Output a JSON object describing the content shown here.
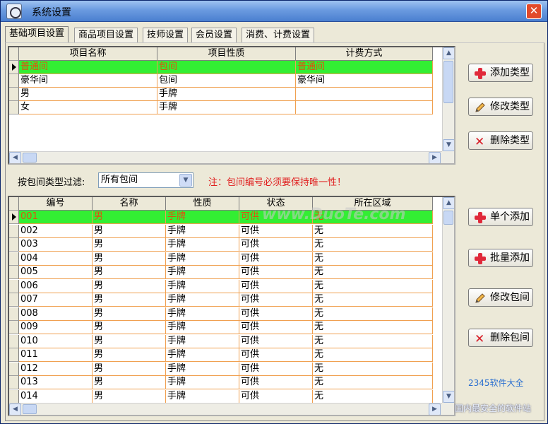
{
  "window": {
    "title": "系统设置",
    "close_label": "✕"
  },
  "tabs": [
    "基础项目设置",
    "商品项目设置",
    "技师设置",
    "会员设置",
    "消费、计费设置"
  ],
  "type_grid": {
    "columns": [
      "项目名称",
      "项目性质",
      "计费方式"
    ],
    "rows": [
      [
        "普通间",
        "包间",
        "普通间"
      ],
      [
        "豪华间",
        "包间",
        "豪华间"
      ],
      [
        "男",
        "手牌",
        ""
      ],
      [
        "女",
        "手牌",
        ""
      ]
    ],
    "selected_index": 0
  },
  "type_buttons": {
    "add": "添加类型",
    "edit": "修改类型",
    "delete": "删除类型"
  },
  "filter": {
    "label": "按包间类型过滤:",
    "value": "所有包间",
    "note": "注：包间编号必须要保持唯一性！"
  },
  "room_grid": {
    "columns": [
      "编号",
      "名称",
      "性质",
      "状态",
      "所在区域"
    ],
    "rows": [
      [
        "001",
        "男",
        "手牌",
        "可供",
        "无"
      ],
      [
        "002",
        "男",
        "手牌",
        "可供",
        "无"
      ],
      [
        "003",
        "男",
        "手牌",
        "可供",
        "无"
      ],
      [
        "004",
        "男",
        "手牌",
        "可供",
        "无"
      ],
      [
        "005",
        "男",
        "手牌",
        "可供",
        "无"
      ],
      [
        "006",
        "男",
        "手牌",
        "可供",
        "无"
      ],
      [
        "007",
        "男",
        "手牌",
        "可供",
        "无"
      ],
      [
        "008",
        "男",
        "手牌",
        "可供",
        "无"
      ],
      [
        "009",
        "男",
        "手牌",
        "可供",
        "无"
      ],
      [
        "010",
        "男",
        "手牌",
        "可供",
        "无"
      ],
      [
        "011",
        "男",
        "手牌",
        "可供",
        "无"
      ],
      [
        "012",
        "男",
        "手牌",
        "可供",
        "无"
      ],
      [
        "013",
        "男",
        "手牌",
        "可供",
        "无"
      ],
      [
        "014",
        "男",
        "手牌",
        "可供",
        "无"
      ]
    ],
    "selected_index": 0
  },
  "room_buttons": {
    "single_add": "单个添加",
    "batch_add": "批量添加",
    "edit": "修改包间",
    "delete": "删除包间"
  },
  "watermarks": {
    "site": "www.DuoTe.com",
    "brand": "2345软件大全",
    "slogan": "国内最安全的软件站"
  },
  "colors": {
    "selected_row": "#33ee33",
    "selected_text": "#e05010",
    "grid_line": "#f0a050",
    "note": "#e02020"
  }
}
